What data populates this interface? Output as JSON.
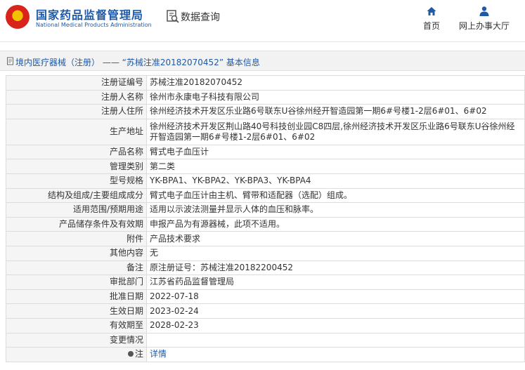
{
  "header": {
    "site_name": "国家药品监督管理局",
    "site_name_en": "National Medical Products Administration",
    "query_label": "数据查询",
    "nav_home": "首页",
    "nav_service": "网上办事大厅"
  },
  "breadcrumb": {
    "text": "境内医疗器械（注册） —— “苏械注准20182070452” 基本信息"
  },
  "rows": [
    {
      "label": "注册证编号",
      "value": "苏械注准20182070452"
    },
    {
      "label": "注册人名称",
      "value": "徐州市永康电子科技有限公司"
    },
    {
      "label": "注册人住所",
      "value": "徐州经济技术开发区乐业路6号联东U谷徐州经开智造园第一期6#号楼1-2层6#01、6#02"
    },
    {
      "label": "生产地址",
      "value": "徐州经济技术开发区荆山路40号科技创业园C8四层,徐州经济技术开发区乐业路6号联东U谷徐州经开智造园第一期6#号楼1-2层6#01、6#02"
    },
    {
      "label": "产品名称",
      "value": "臂式电子血压计"
    },
    {
      "label": "管理类别",
      "value": "第二类"
    },
    {
      "label": "型号规格",
      "value": "YK-BPA1、YK-BPA2、YK-BPA3、YK-BPA4"
    },
    {
      "label": "结构及组成/主要组成成分",
      "value": "臂式电子血压计由主机、臂带和适配器（选配）组成。"
    },
    {
      "label": "适用范围/预期用途",
      "value": "适用以示波法测量并显示人体的血压和脉率。"
    },
    {
      "label": "产品储存条件及有效期",
      "value": "申报产品为有源器械，此项不适用。"
    },
    {
      "label": "附件",
      "value": "产品技术要求"
    },
    {
      "label": "其他内容",
      "value": "无"
    },
    {
      "label": "备注",
      "value": "原注册证号：苏械注准20182200452"
    },
    {
      "label": "审批部门",
      "value": "江苏省药品监督管理局"
    },
    {
      "label": "批准日期",
      "value": "2022-07-18"
    },
    {
      "label": "生效日期",
      "value": "2023-02-24"
    },
    {
      "label": "有效期至",
      "value": "2028-02-23"
    },
    {
      "label": "变更情况",
      "value": ""
    },
    {
      "label": "注",
      "value": "详情"
    }
  ]
}
